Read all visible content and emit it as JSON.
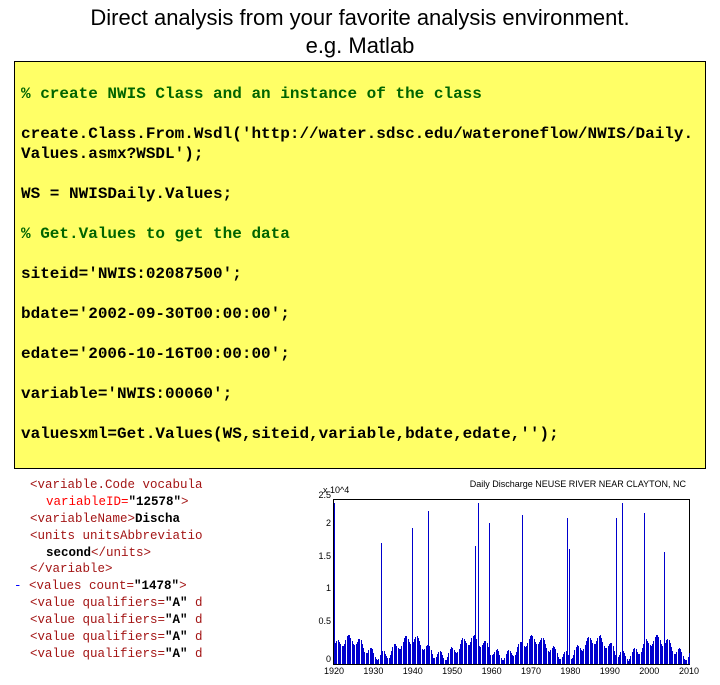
{
  "title_line1": "Direct analysis from your favorite analysis environment.",
  "title_line2": "e.g. Matlab",
  "code": {
    "l1": "% create NWIS Class and an instance of the class",
    "l2": "create.Class.From.Wsdl('http://water.sdsc.edu/wateroneflow/NWIS/Daily.Values.asmx?WSDL');",
    "l3": "WS = NWISDaily.Values;",
    "l4": "% Get.Values to get the data",
    "l5": "siteid='NWIS:02087500';",
    "l6": "bdate='2002-09-30T00:00:00';",
    "l7": "edate='2006-10-16T00:00:00';",
    "l8": "variable='NWIS:00060';",
    "l9": "valuesxml=Get.Values(WS,siteid,variable,bdate,edate,'');"
  },
  "xml": {
    "r1_attr_name": "variableID=",
    "r1_attr_val": "\"12578\"",
    "r0_tag": "<variable.Code vocabula",
    "r2_tag": "<variableName>",
    "r2_txt": "Discha",
    "r3_tag": "<units unitsAbbreviatio",
    "r4_txt": "second",
    "r4_close": "</units>",
    "r5_close": "</variable>",
    "r6_prefix": "- ",
    "r6_tag": "<values count=",
    "r6_val": "\"1478\"",
    "r6_end": ">",
    "r7_tag": "<value qualifiers=",
    "r7_val": "\"A\"",
    "r7_end": " d"
  },
  "chart_data": {
    "type": "line",
    "title": "Daily Discharge NEUSE RIVER NEAR CLAYTON, NC",
    "y_exponent": "x 10^4",
    "xlabel": "",
    "ylabel": "",
    "xticks": [
      1920,
      1930,
      1940,
      1950,
      1960,
      1970,
      1980,
      1990,
      2000,
      2010
    ],
    "yticks": [
      0,
      0.5,
      1,
      1.5,
      2,
      2.5
    ],
    "xlim": [
      1920,
      2010
    ],
    "ylim": [
      0,
      2.5
    ],
    "note": "Dense daily streamflow time series; values approximate, peaks reach ~2.5e4."
  }
}
